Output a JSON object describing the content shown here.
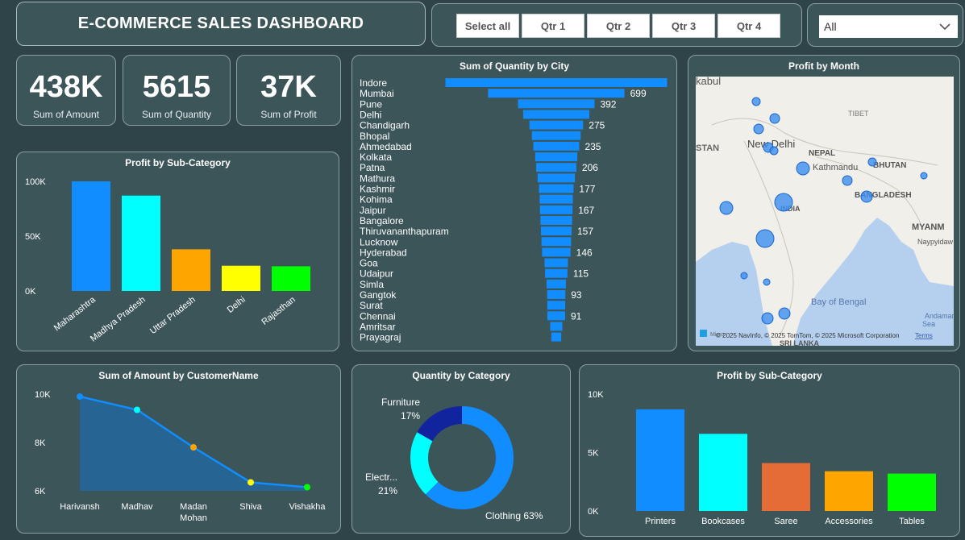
{
  "header": {
    "title": "E-COMMERCE SALES DASHBOARD"
  },
  "slicer": {
    "buttons": [
      "Select all",
      "Qtr 1",
      "Qtr 2",
      "Qtr 3",
      "Qtr 4"
    ],
    "dropdown_value": "All"
  },
  "kpis": [
    {
      "value": "438K",
      "label": "Sum of Amount"
    },
    {
      "value": "5615",
      "label": "Sum of Quantity"
    },
    {
      "value": "37K",
      "label": "Sum of Profit"
    }
  ],
  "map": {
    "title": "Profit by Month",
    "labels": [
      "kabul",
      "STAN",
      "New Delhi",
      "TIBET",
      "NEPAL",
      "Kathmandu",
      "BHUTAN",
      "BANGLADESH",
      "INDIA",
      "MYANM",
      "Naypyidaw",
      "Bay of Bengal",
      "Andaman Sea",
      "SRI LANKA"
    ],
    "attribution": "© 2025 NavInfo, © 2025 TomTom, © 2025 Microsoft Corporation",
    "terms": "Terms",
    "logo_text": "Micro"
  },
  "chart_data": [
    {
      "id": "profit_by_state",
      "type": "bar",
      "title": "Profit by Sub-Category",
      "categories": [
        "Maharashtra",
        "Madhya Pradesh",
        "Uttar Pradesh",
        "Delhi",
        "Rajasthan"
      ],
      "values": [
        101000,
        87000,
        38000,
        23000,
        22500
      ],
      "colors": [
        "#118dff",
        "#00ffff",
        "#ffa500",
        "#ffff00",
        "#00ff00"
      ],
      "yticks": [
        "0K",
        "50K",
        "100K"
      ],
      "ylim": [
        0,
        100000
      ]
    },
    {
      "id": "quantity_by_city",
      "type": "bar",
      "orientation": "horizontal",
      "title": "Sum of Quantity by City",
      "categories": [
        "Indore",
        "Mumbai",
        "Pune",
        "Delhi",
        "Chandigarh",
        "Bhopal",
        "Ahmedabad",
        "Kolkata",
        "Patna",
        "Mathura",
        "Kashmir",
        "Kohima",
        "Jaipur",
        "Bangalore",
        "Thiruvananthapuram",
        "Lucknow",
        "Hyderabad",
        "Goa",
        "Udaipur",
        "Simla",
        "Gangtok",
        "Surat",
        "Chennai",
        "Amritsar",
        "Prayagraj"
      ],
      "values": [
        1136,
        699,
        392,
        339,
        275,
        250,
        235,
        216,
        206,
        191,
        177,
        170,
        167,
        162,
        157,
        152,
        146,
        120,
        115,
        99,
        93,
        92,
        91,
        62,
        51
      ],
      "data_labels": [
        "",
        "699",
        "392",
        "",
        "275",
        "",
        "235",
        "",
        "206",
        "",
        "177",
        "",
        "167",
        "",
        "157",
        "",
        "146",
        "",
        "115",
        "",
        "93",
        "",
        "91",
        "",
        ""
      ],
      "color": "#118dff"
    },
    {
      "id": "amount_by_customer",
      "type": "area",
      "title": "Sum of Amount by CustomerName",
      "categories": [
        "Harivansh",
        "Madhav",
        "Madan Mohan",
        "Shiva",
        "Vishakha"
      ],
      "values": [
        9900,
        9350,
        7800,
        6350,
        6150
      ],
      "point_colors": [
        "#118dff",
        "#00ffff",
        "#ffa500",
        "#ffff00",
        "#00ff00"
      ],
      "yticks": [
        "6K",
        "8K",
        "10K"
      ],
      "ylim": [
        6000,
        10000
      ]
    },
    {
      "id": "quantity_by_category",
      "type": "pie",
      "title": "Quantity by Category",
      "slices": [
        {
          "label": "Clothing",
          "pct": "63%",
          "value": 63,
          "color": "#118dff"
        },
        {
          "label": "Electr...",
          "pct": "21%",
          "value": 21,
          "color": "#00ffff"
        },
        {
          "label": "Furniture",
          "pct": "17%",
          "value": 17,
          "color": "#12239e"
        }
      ]
    },
    {
      "id": "profit_by_subcategory",
      "type": "bar",
      "title": "Profit by Sub-Category",
      "categories": [
        "Printers",
        "Bookcases",
        "Saree",
        "Accessories",
        "Tables"
      ],
      "values": [
        8700,
        6600,
        4100,
        3400,
        3200
      ],
      "colors": [
        "#118dff",
        "#00ffff",
        "#e66c37",
        "#ffa500",
        "#00ff00"
      ],
      "yticks": [
        "0K",
        "5K",
        "10K"
      ],
      "ylim": [
        0,
        10000
      ]
    }
  ]
}
